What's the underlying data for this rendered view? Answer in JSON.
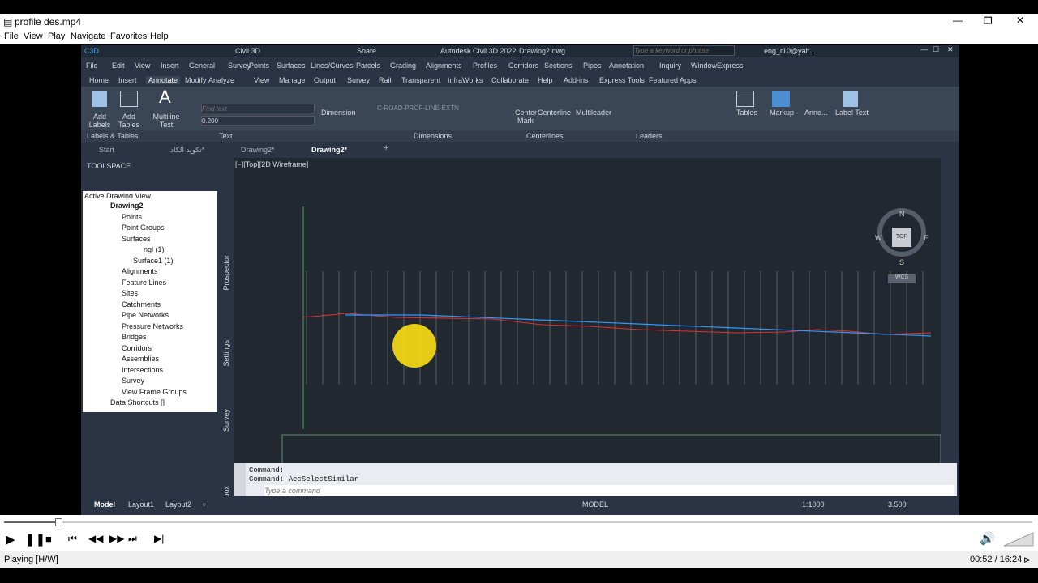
{
  "player": {
    "title": "profile des.mp4",
    "menu": [
      "File",
      "View",
      "Play",
      "Navigate",
      "Favorites",
      "Help"
    ],
    "status": "Playing [H/W]",
    "time": "00:52 / 16:24",
    "progress": 0.053
  },
  "acad": {
    "workspace": "Civil 3D",
    "share": "Share",
    "app_title": "Autodesk Civil 3D 2022",
    "drawing_title": "Drawing2.dwg",
    "search_placeholder": "Type a keyword or phrase",
    "user": "eng_r10@yah...",
    "menu": [
      "File",
      "Edit",
      "View",
      "Insert",
      "General",
      "Survey",
      "Points",
      "Surfaces",
      "Lines/Curves",
      "Parcels",
      "Grading",
      "Alignments",
      "Profiles",
      "Corridors",
      "Sections",
      "Pipes",
      "Annotation",
      "Inquiry",
      "Window",
      "Express"
    ],
    "ribbon_tabs": [
      "Home",
      "Insert",
      "Annotate",
      "Modify",
      "Analyze",
      "View",
      "Manage",
      "Output",
      "Survey",
      "Rail",
      "Transparent",
      "InfraWorks",
      "Collaborate",
      "Help",
      "Add-ins",
      "Express Tools",
      "Featured Apps"
    ],
    "ribbon": {
      "add_labels": "Add Labels",
      "add_tables": "Add Tables",
      "multiline_text": "Multiline Text",
      "find_placeholder": "Find text",
      "text_height": "0.200",
      "dimension": "Dimension",
      "dim_style": "C-ROAD-PROF-LINE-EXTN",
      "center_mark": "Center Mark",
      "centerline": "Centerline",
      "multileader": "Multileader",
      "tables": "Tables",
      "markup": "Markup",
      "anno": "Anno...",
      "label_text": "Label Text"
    },
    "ribbon_groups": [
      "Labels & Tables",
      "Text",
      "Dimensions",
      "Centerlines",
      "Leaders"
    ],
    "doc_tabs": [
      "Start",
      "تكويد الكاد*",
      "Drawing2*",
      "Drawing2*"
    ],
    "toolspace": {
      "title": "TOOLSPACE",
      "view": "Active Drawing View",
      "side_tabs": [
        "Prospector",
        "Settings",
        "Survey",
        "Toolbox"
      ],
      "tree": [
        "Drawing2",
        "Points",
        "Point Groups",
        "Surfaces",
        "ngl (1)",
        "Surface1 (1)",
        "Alignments",
        "Feature Lines",
        "Sites",
        "Catchments",
        "Pipe Networks",
        "Pressure Networks",
        "Bridges",
        "Corridors",
        "Assemblies",
        "Intersections",
        "Survey",
        "View Frame Groups",
        "Data Shortcuts []"
      ]
    },
    "viewport_label": "[−][Top][2D Wireframe]",
    "compass": {
      "n": "N",
      "s": "S",
      "e": "E",
      "w": "W",
      "top": "TOP",
      "wcs": "WCS"
    },
    "command": {
      "line1": "Command:",
      "line2": "Command: AecSelectSimilar",
      "placeholder": "Type a command"
    },
    "layouts": [
      "Model",
      "Layout1",
      "Layout2"
    ],
    "status": {
      "model": "MODEL",
      "scale": "1:1000",
      "lineweight": "3.500"
    }
  }
}
